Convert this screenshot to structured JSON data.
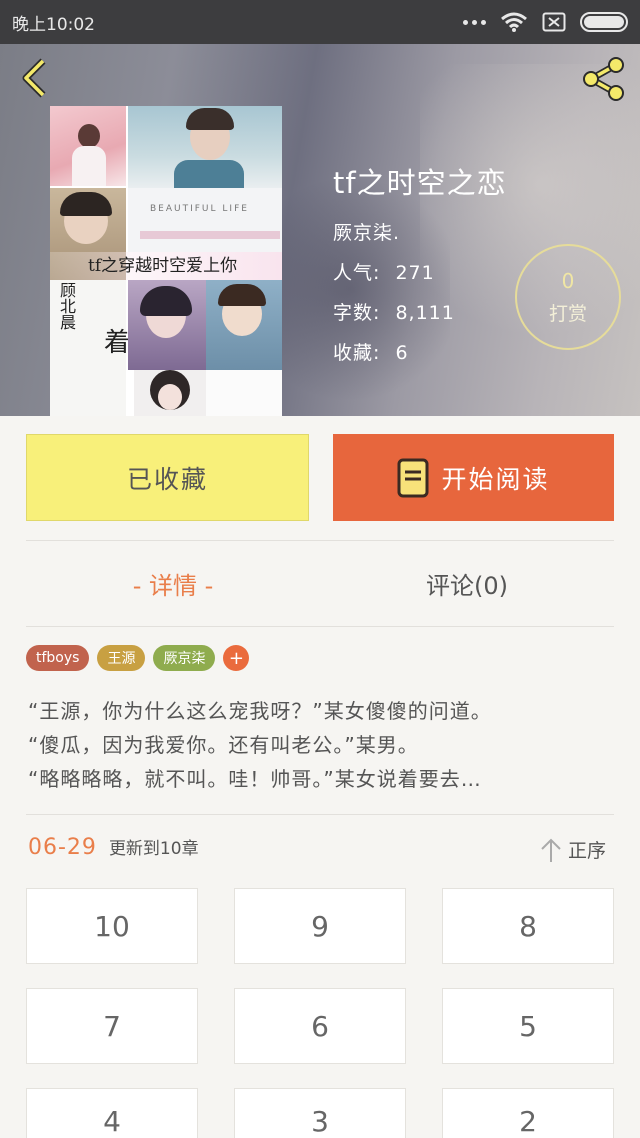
{
  "status_bar": {
    "time": "晚上10:02"
  },
  "book": {
    "title": "tf之时空之恋",
    "author": "厥京柒.",
    "popularity_label": "人气:",
    "popularity": "271",
    "word_count_label": "字数:",
    "word_count": "8,111",
    "favorites_label": "收藏:",
    "favorites": "6",
    "cover": {
      "banner_text": "tf之穿越时空爱上你",
      "beautiful_text": "BEAUTIFUL LIFE",
      "side_text": "顾北晨",
      "side_text2": "着"
    }
  },
  "reward": {
    "count": "0",
    "label": "打赏"
  },
  "actions": {
    "favorite_label": "已收藏",
    "read_label": "开始阅读"
  },
  "tabs": {
    "detail": "- 详情 -",
    "comments": "评论(0)"
  },
  "tags": [
    {
      "label": "tfboys",
      "color": "#c1634d"
    },
    {
      "label": "王源",
      "color": "#c8a042"
    },
    {
      "label": "厥京柒",
      "color": "#8fac4e"
    }
  ],
  "tag_add": "+",
  "description": [
    "“王源，你为什么这么宠我呀？”某女傻傻的问道。",
    "“傻瓜，因为我爱你。还有叫老公。”某男。",
    "“略略略略，就不叫。哇！帅哥。”某女说着要去…"
  ],
  "update": {
    "date": "06-29",
    "text": "更新到10章"
  },
  "sort": {
    "label": "正序"
  },
  "chapters": [
    "10",
    "9",
    "8",
    "7",
    "6",
    "5",
    "4",
    "3",
    "2"
  ],
  "colors": {
    "accent": "#e97e4a",
    "read_button": "#e7663d",
    "fav_button": "#f8f07a",
    "reward_ring": "#e6dc9a"
  }
}
